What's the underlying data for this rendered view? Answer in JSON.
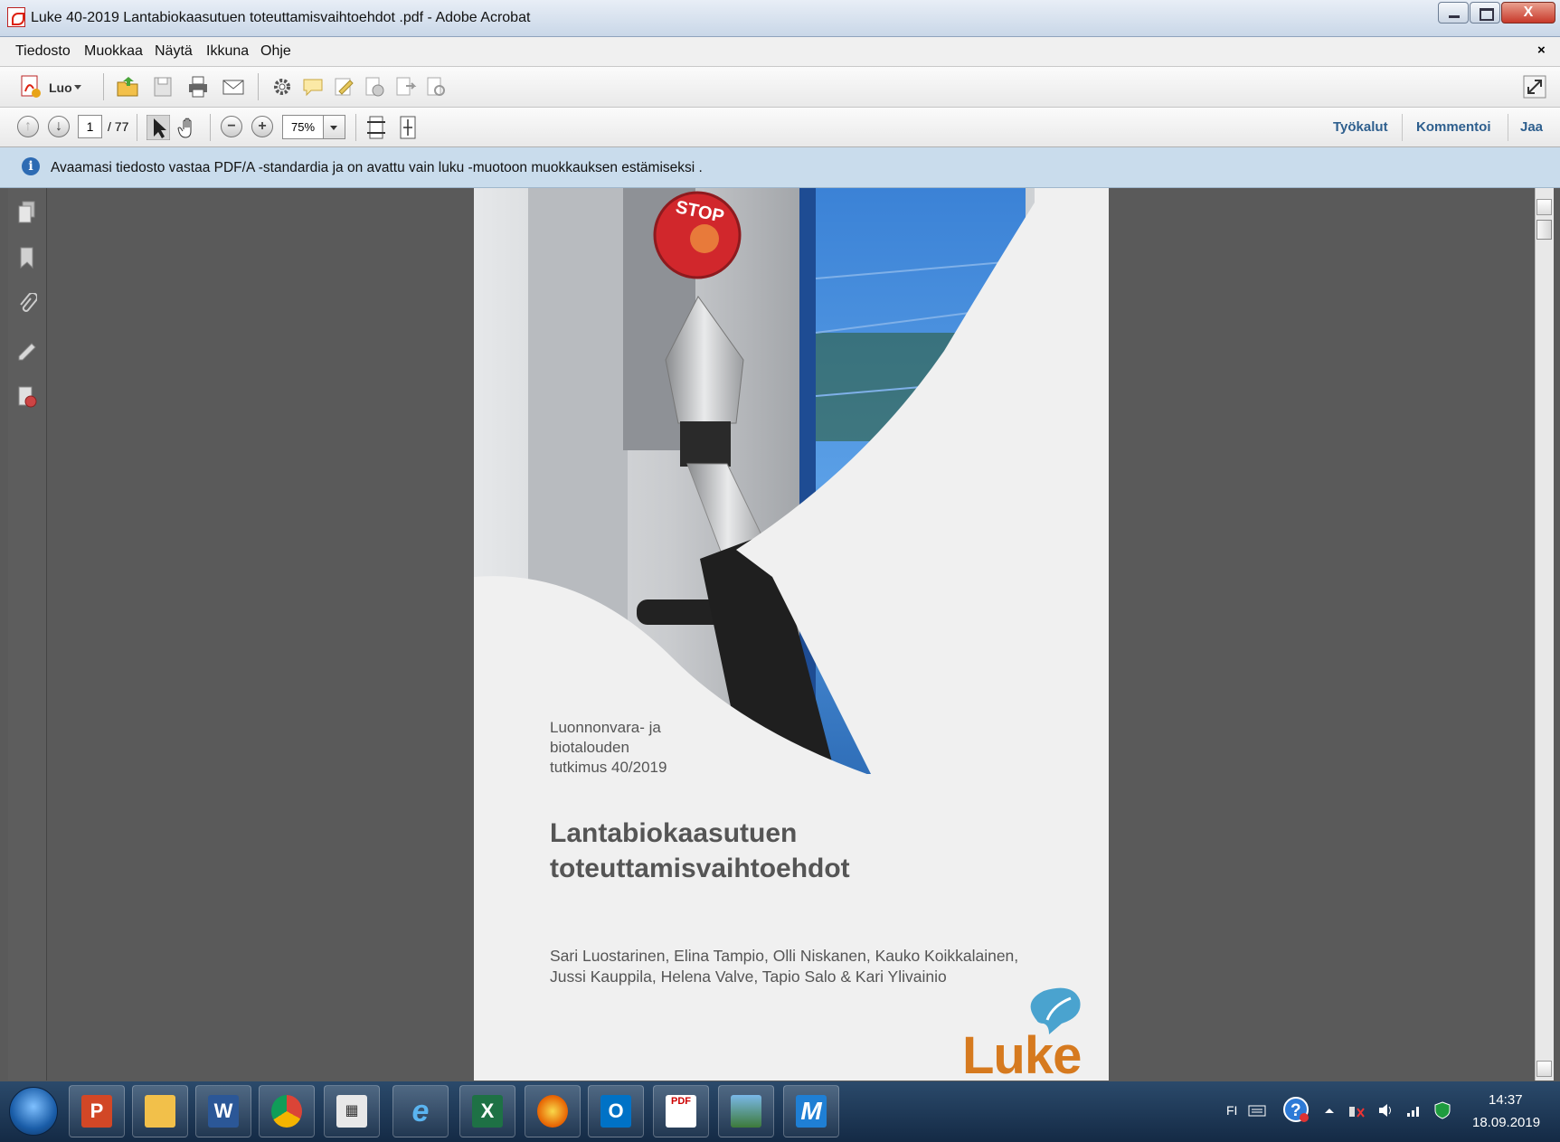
{
  "window": {
    "title": "Luke 40-2019 Lantabiokaasutuen toteuttamisvaihtoehdot .pdf - Adobe Acrobat",
    "close_symbol": "X"
  },
  "menubar": {
    "items": [
      "Tiedosto",
      "Muokkaa",
      "Näytä",
      "Ikkuna",
      "Ohje"
    ],
    "close_symbol": "×"
  },
  "toolbar1": {
    "create_label": "Luo",
    "icons": [
      "create-pdf-icon",
      "open-folder-icon",
      "save-icon",
      "print-icon",
      "email-icon",
      "gear-icon",
      "comment-icon",
      "sign-icon",
      "protect-icon",
      "export-icon",
      "share-icon",
      "expand-icon"
    ]
  },
  "toolbar2": {
    "current_page": "1",
    "total_pages": "/ 77",
    "zoom": "75%",
    "links": [
      "Työkalut",
      "Kommentoi",
      "Jaa"
    ]
  },
  "infobar": {
    "message": "Avaamasi tiedosto vastaa PDF/A -standardia ja on avattu vain luku -muotoon muokkauksen estämiseksi ."
  },
  "document": {
    "photo_text": "STOP",
    "series": [
      "Luonnonvara- ja",
      "biotalouden",
      "tutkimus 40/2019"
    ],
    "title": [
      "Lantabiokaasutuen",
      "toteuttamisvaihtoehdot"
    ],
    "authors": [
      "Sari Luostarinen, Elina Tampio, Olli Niskanen, Kauko Koikkalainen,",
      "Jussi Kauppila, Helena Valve, Tapio Salo & Kari Ylivainio"
    ],
    "logo_text": "Luke",
    "logo_color": "#d67a1f"
  },
  "taskbar": {
    "apps": [
      "powerpoint-icon",
      "file-explorer-icon",
      "word-icon",
      "chrome-icon",
      "calculator-icon",
      "internet-explorer-icon",
      "excel-icon",
      "firefox-icon",
      "outlook-icon",
      "acrobat-icon",
      "photos-icon",
      "m-app-icon"
    ],
    "language": "FI",
    "time": "14:37",
    "date": "18.09.2019"
  }
}
